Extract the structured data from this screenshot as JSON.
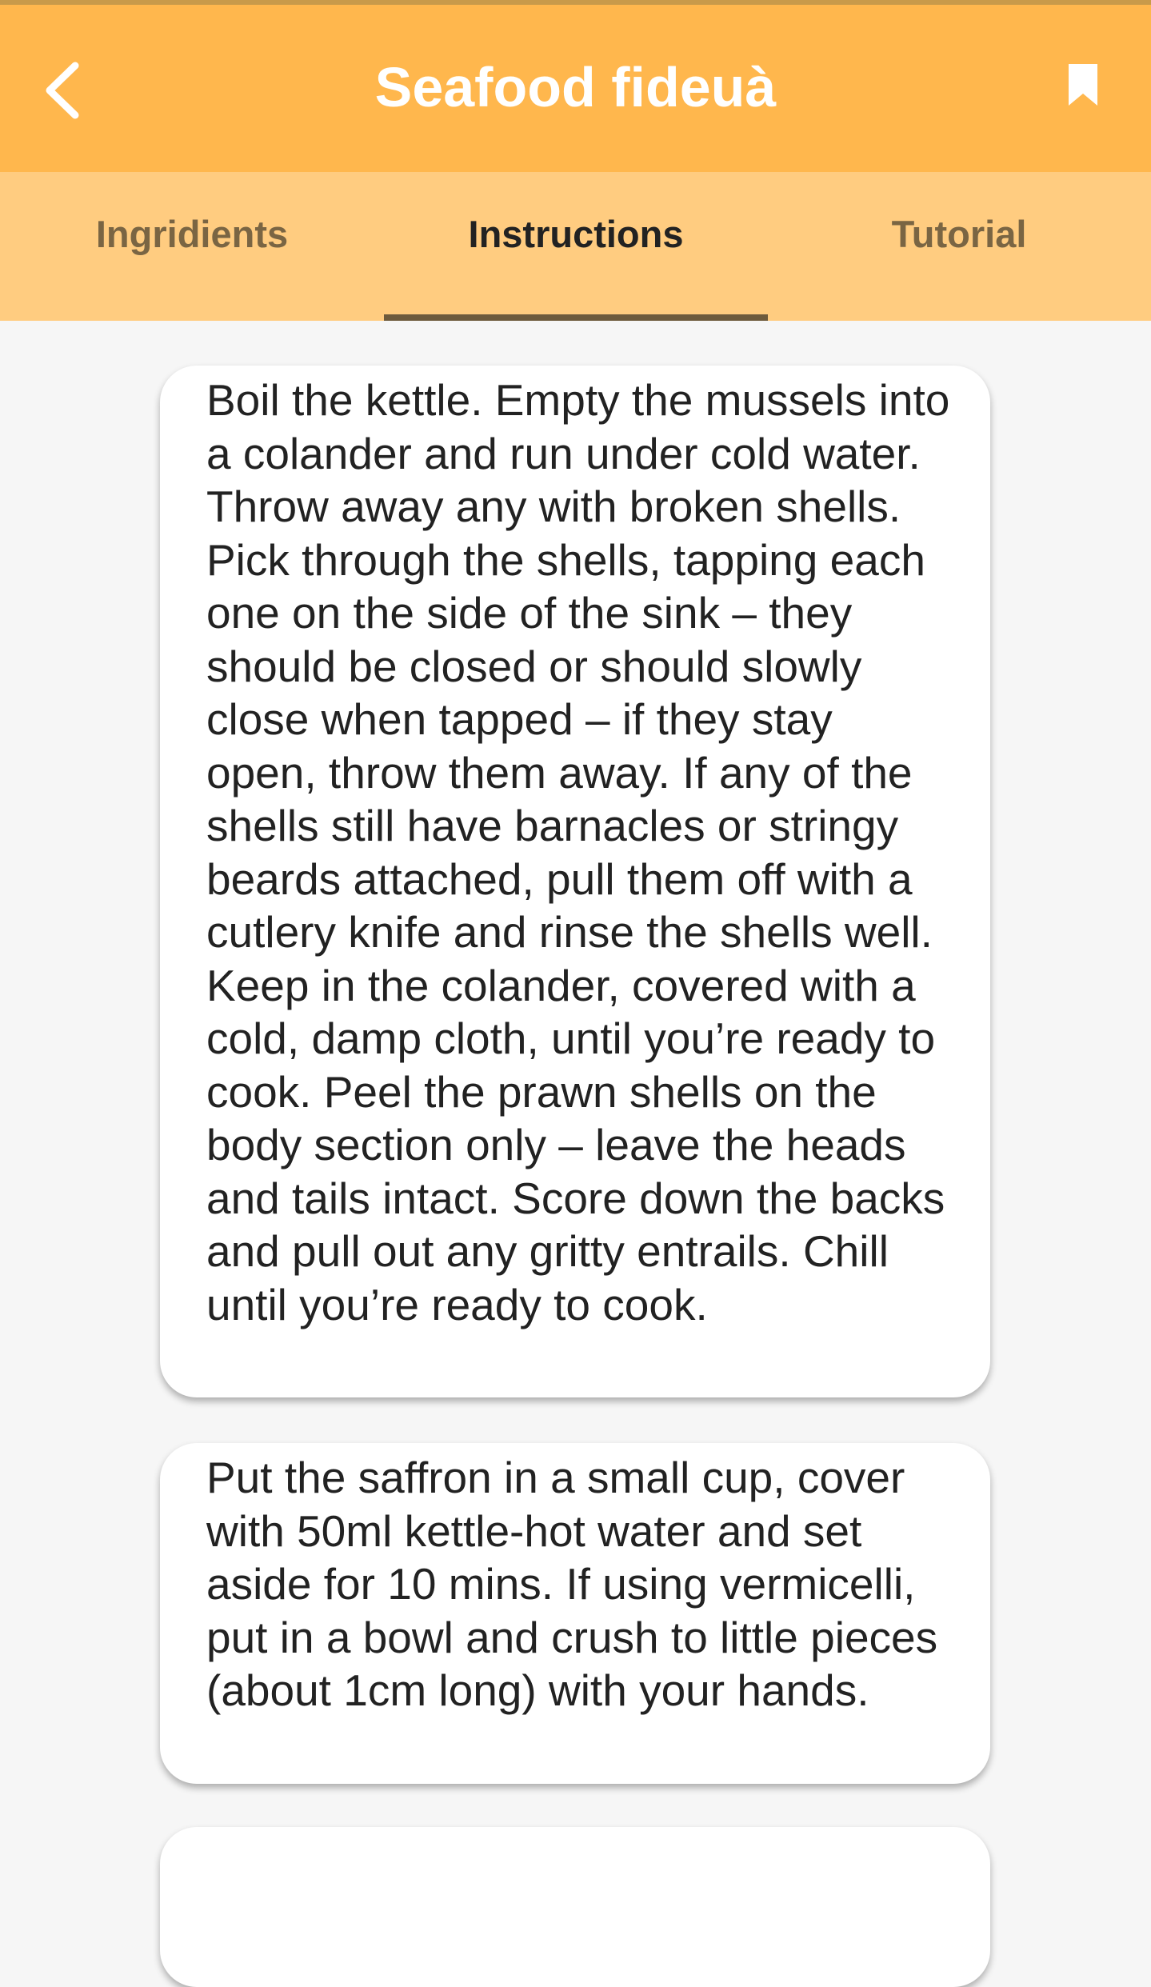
{
  "header": {
    "title": "Seafood fideuà",
    "back_icon": "chevron-left-icon",
    "bookmark_icon": "bookmark-icon",
    "color": "#ffb74d"
  },
  "tabs": {
    "color": "#ffcc80",
    "items": [
      {
        "label": "Ingridients",
        "active": false
      },
      {
        "label": "Instructions",
        "active": true
      },
      {
        "label": "Tutorial",
        "active": false
      }
    ]
  },
  "instructions": [
    "Boil the kettle. Empty the mussels into a colander and run under cold water. Throw away any with broken shells. Pick through the shells, tapping each one on the side of the sink – they should be closed or should slowly close when tapped – if they stay open, throw them away. If any of the shells still have barnacles or stringy beards attached, pull them off with a cutlery knife and rinse the shells well. Keep in the colander, covered with a cold, damp cloth, until you’re ready to cook. Peel the prawn shells on the body section only – leave the heads and tails intact. Score down the backs and pull out any gritty entrails. Chill until you’re ready to cook.",
    "Put the saffron in a small cup, cover with 50ml kettle-hot water and set aside for 10 mins. If using vermicelli, put in a bowl and crush to little pieces (about 1cm long) with your hands."
  ]
}
